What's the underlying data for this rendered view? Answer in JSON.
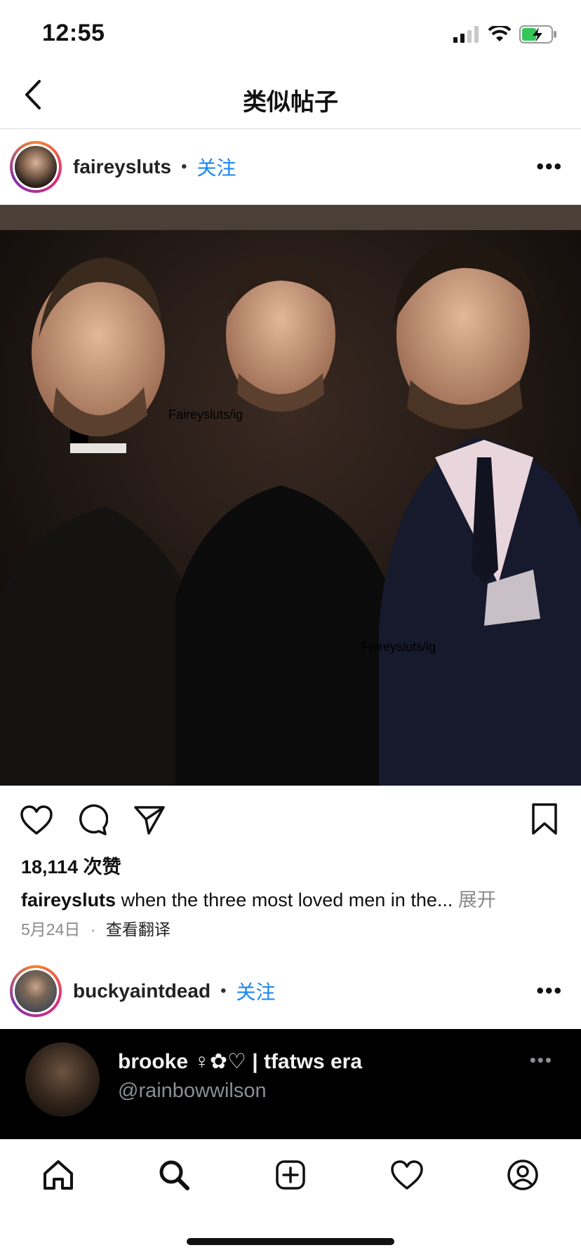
{
  "status": {
    "time": "12:55",
    "icons": [
      "signal-icon",
      "wifi-icon",
      "battery-charging-icon"
    ]
  },
  "nav": {
    "title": "类似帖子",
    "back_icon": "chevron-left-icon"
  },
  "posts": [
    {
      "username": "faireysluts",
      "separator": "•",
      "follow_label": "关注",
      "more_label": "•••",
      "watermark": "Faireysluts/ig",
      "likes": "18,114 次赞",
      "caption_user": "faireysluts",
      "caption_text": "when the three most loved men in the...",
      "caption_expand": "展开",
      "date": "5月24日",
      "date_sep": "·",
      "translate_label": "查看翻译"
    },
    {
      "username": "buckyaintdead",
      "separator": "•",
      "follow_label": "关注",
      "more_label": "•••"
    }
  ],
  "tweet": {
    "name": "brooke ♀✿♡ | tfatws era",
    "handle": "@rainbowwilson",
    "more_label": "•••"
  },
  "tabbar": [
    "home-icon",
    "search-icon",
    "add-post-icon",
    "activity-heart-icon",
    "profile-icon"
  ],
  "colors": {
    "accent": "#1c86f2",
    "text": "#111111",
    "muted": "#8a8a8a"
  }
}
